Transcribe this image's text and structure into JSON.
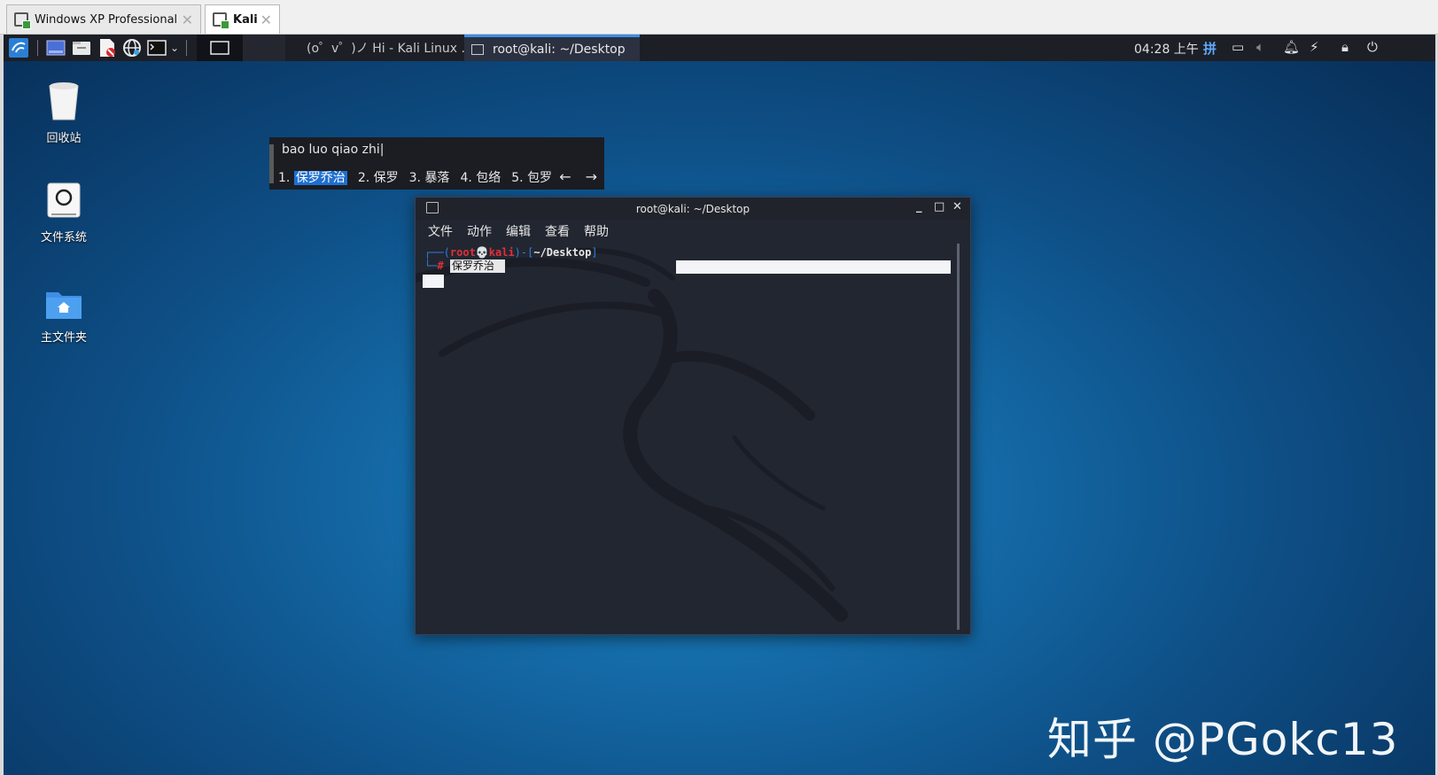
{
  "host_tabs": [
    {
      "label": "Windows XP Professional",
      "active": false
    },
    {
      "label": "Kali",
      "active": true
    }
  ],
  "panel": {
    "launchers": [
      "kali-menu-icon",
      "workspace-icon",
      "files-icon",
      "text-editor-icon",
      "browser-icon",
      "terminal-icon"
    ],
    "tasks": [
      {
        "label": "(o゜v゜)ノ Hi - Kali Linux ...",
        "active": false
      },
      {
        "label": "root@kali: ~/Desktop",
        "active": true
      }
    ],
    "clock": "04:28 上午",
    "ime_indicator": "拼"
  },
  "desktop_icons": [
    {
      "label": "回收站"
    },
    {
      "label": "文件系统"
    },
    {
      "label": "主文件夹"
    }
  ],
  "ime": {
    "preedit": "bao luo qiao zhi|",
    "candidates": [
      {
        "num": "1.",
        "text": "保罗乔治",
        "selected": true
      },
      {
        "num": "2.",
        "text": "保罗",
        "selected": false
      },
      {
        "num": "3.",
        "text": "暴落",
        "selected": false
      },
      {
        "num": "4.",
        "text": "包络",
        "selected": false
      },
      {
        "num": "5.",
        "text": "包罗",
        "selected": false
      }
    ],
    "prev": "←",
    "next": "→"
  },
  "terminal": {
    "title": "root@kali: ~/Desktop",
    "menu": [
      "文件",
      "动作",
      "编辑",
      "查看",
      "帮助"
    ],
    "prompt_user": "root",
    "prompt_host": "kali",
    "prompt_dir": "~/Desktop",
    "prompt_symbol": "#",
    "preedit_text": "保罗乔治",
    "minimize": "_",
    "maximize": "□",
    "close": "✕"
  },
  "watermark": "知乎 @PGokc13",
  "colors": {
    "panel_bg": "#1c1f26",
    "terminal_bg": "#222631",
    "prompt_blue": "#2f7de1",
    "prompt_red": "#e0303a",
    "ime_highlight": "#1f6fd0"
  }
}
